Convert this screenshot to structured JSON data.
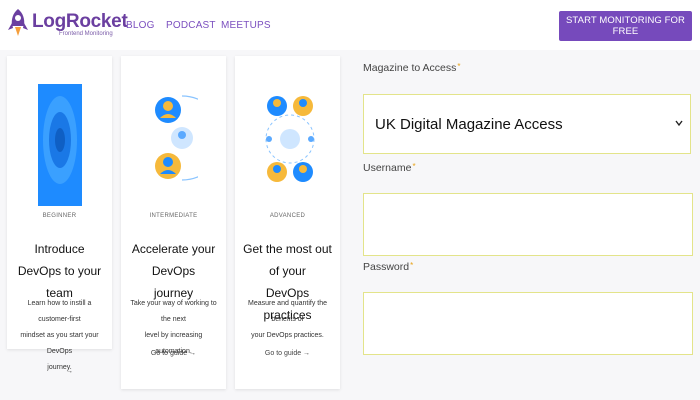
{
  "header": {
    "brand": "LogRocket",
    "tagline": "Frontend Monitoring",
    "nav": [
      "BLOG",
      "PODCAST",
      "MEETUPS"
    ],
    "cta_label": "START MONITORING FOR FREE"
  },
  "cards": [
    {
      "level": "BEGINNER",
      "title_line1": "Introduce DevOps to your",
      "title_line2": "team",
      "desc_line1": "Learn how to instill a customer-first",
      "desc_line2": "mindset as you start your DevOps",
      "desc_line3": "journey.",
      "link": "→"
    },
    {
      "level": "INTERMEDIATE",
      "title_line1": "Accelerate your DevOps",
      "title_line2": "journey",
      "desc_line1": "Take your way of working to the next",
      "desc_line2": "level by increasing automation.",
      "link": "Go to guide →"
    },
    {
      "level": "ADVANCED",
      "title_line1": "Get the most out of your",
      "title_line2": "DevOps practices",
      "desc_line1": "Measure and quantify the benefits of",
      "desc_line2": "your DevOps practices.",
      "link": "Go to guide →"
    }
  ],
  "form": {
    "magazine_label": "Magazine to Access",
    "magazine_value": "UK Digital Magazine Access",
    "username_label": "Username",
    "username_value": "",
    "password_label": "Password",
    "password_value": "",
    "required_mark": "*"
  },
  "colors": {
    "brand_purple": "#764abc",
    "field_border": "#e3e48a",
    "required": "#e8a317"
  }
}
